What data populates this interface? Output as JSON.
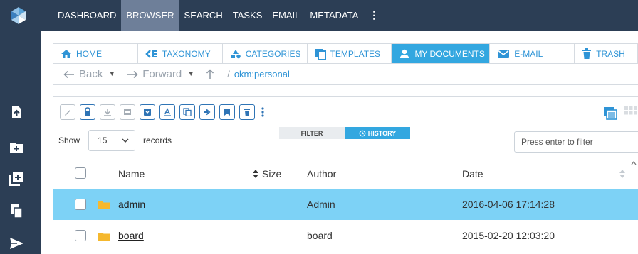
{
  "topnav": {
    "items": [
      {
        "label": "DASHBOARD",
        "active": false
      },
      {
        "label": "BROWSER",
        "active": true
      },
      {
        "label": "SEARCH",
        "active": false
      },
      {
        "label": "TASKS",
        "active": false
      },
      {
        "label": "EMAIL",
        "active": false
      },
      {
        "label": "METADATA",
        "active": false
      }
    ],
    "more": "⋮"
  },
  "sidebar": {
    "icons": [
      "add-document-icon",
      "add-folder-icon",
      "add-item-icon",
      "copy-icon",
      "send-icon"
    ]
  },
  "tabs": [
    {
      "label": "HOME",
      "icon": "home-icon"
    },
    {
      "label": "TAXONOMY",
      "icon": "taxonomy-icon"
    },
    {
      "label": "CATEGORIES",
      "icon": "categories-icon"
    },
    {
      "label": "TEMPLATES",
      "icon": "templates-icon"
    },
    {
      "label": "MY DOCUMENTS",
      "icon": "user-icon",
      "active": true
    },
    {
      "label": "E-MAIL",
      "icon": "mail-icon"
    },
    {
      "label": "TRASH",
      "icon": "trash-icon"
    }
  ],
  "navbar": {
    "back": "Back",
    "forward": "Forward",
    "path_sep": "/",
    "path": "okm:personal"
  },
  "toolbar": {
    "buttons": [
      "edit-icon",
      "lock-icon",
      "download-icon",
      "scanner-icon",
      "archive-icon",
      "text-icon",
      "copy-icon",
      "move-icon",
      "bookmark-icon",
      "delete-icon"
    ]
  },
  "list": {
    "show_label": "Show",
    "page_size": "15",
    "records_label": "records",
    "filter_tab": "FILTER",
    "history_tab": "HISTORY",
    "filter_placeholder": "Press enter to filter"
  },
  "table": {
    "columns": {
      "name": "Name",
      "size": "Size",
      "author": "Author",
      "date": "Date"
    },
    "rows": [
      {
        "name": "admin",
        "author": "Admin",
        "date": "2016-04-06 17:14:28",
        "selected": true
      },
      {
        "name": "board",
        "author": "board",
        "date": "2015-02-20 12:03:20",
        "selected": false
      }
    ]
  },
  "colors": {
    "nav_bg": "#2c3e55",
    "accent": "#33a7e0",
    "selected_row": "#7dd2f6",
    "link": "#2f94d6"
  }
}
